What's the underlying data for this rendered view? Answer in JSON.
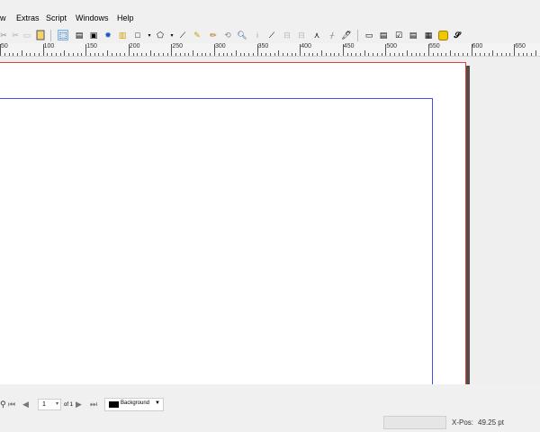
{
  "menu": [
    "w",
    "Extras",
    "Script",
    "Windows",
    "Help"
  ],
  "toolbar": {
    "icons": [
      "cut-icon",
      "copy-icon",
      "paste-icon",
      "select-icon",
      "text-frame-icon",
      "image-frame-icon",
      "render-frame-icon",
      "table-icon",
      "shape-icon",
      "polygon-icon",
      "line-icon",
      "bezier-icon",
      "freehand-icon",
      "rotate-icon",
      "zoom-icon",
      "edit-text-icon",
      "link-frames-icon",
      "unlink-frames-icon",
      "measure-icon",
      "copy-properties-icon",
      "eyedropper-icon",
      "pdf-button-icon",
      "pdf-textfield-icon",
      "pdf-checkbox-icon",
      "pdf-combobox-icon",
      "pdf-listbox-icon",
      "pdf-text-annotation-icon",
      "pdf-link-annotation-icon"
    ]
  },
  "ruler": {
    "labels": [
      "50",
      "100",
      "150",
      "200",
      "250",
      "300",
      "350",
      "400",
      "450",
      "500",
      "550",
      "600",
      "650"
    ]
  },
  "pagebar": {
    "page_value": "1",
    "of_label": "of 1",
    "layer_label": "Background"
  },
  "status": {
    "xpos_label": "X-Pos:",
    "xpos_value": "49.25 pt"
  },
  "colors": {
    "page_border": "#e04040",
    "margin_guide": "#4a4af0"
  }
}
